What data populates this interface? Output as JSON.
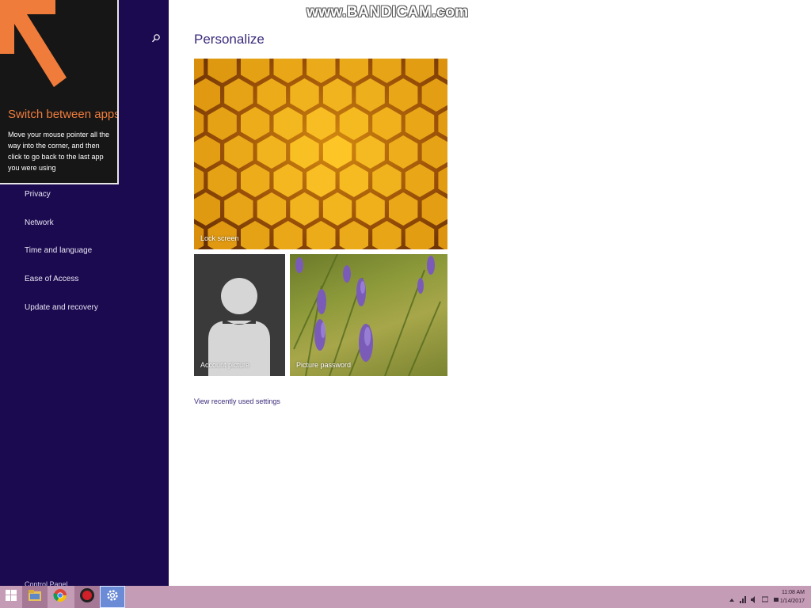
{
  "watermark": "www.BANDICAM.com",
  "tip": {
    "title": "Switch between apps",
    "body": "Move your mouse pointer all the way into the corner, and then click to go back to the last app you were using",
    "arrow_color": "#f07c3c"
  },
  "sidebar": {
    "search_icon": "search-icon",
    "items": [
      {
        "label": "Privacy"
      },
      {
        "label": "Network"
      },
      {
        "label": "Time and language"
      },
      {
        "label": "Ease of Access"
      },
      {
        "label": "Update and recovery"
      }
    ],
    "bottom_link": "Control Panel",
    "background": "#1b0a4f"
  },
  "main": {
    "title": "Personalize",
    "tiles": [
      {
        "label": "Lock screen"
      },
      {
        "label": "Account picture"
      },
      {
        "label": "Picture password"
      }
    ],
    "recent_link": "View recently used settings"
  },
  "taskbar": {
    "background": "#c59cb6",
    "buttons": [
      {
        "icon": "windows-start-icon"
      },
      {
        "icon": "file-explorer-icon"
      },
      {
        "icon": "chrome-icon"
      },
      {
        "icon": "bandicam-record-icon"
      },
      {
        "icon": "pc-settings-icon"
      }
    ],
    "tray_icons": [
      "show-hidden-icons-icon",
      "network-icon",
      "volume-icon",
      "action-center-icon",
      "power-icon"
    ],
    "time": "11:08 AM",
    "date": "1/14/2017"
  }
}
